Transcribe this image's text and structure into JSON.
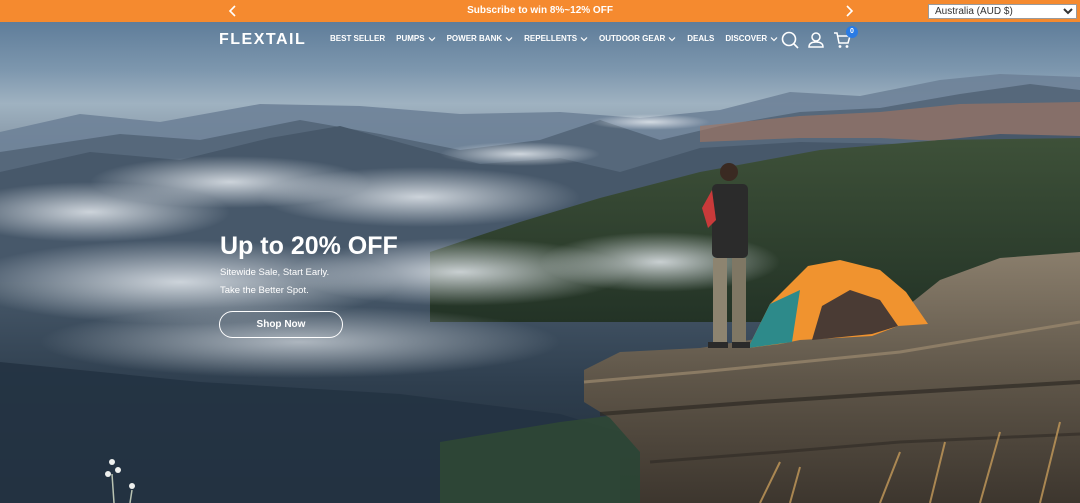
{
  "announcement": {
    "text": "Subscribe to win 8%~12% OFF",
    "background": "#f58a2f"
  },
  "region_select": {
    "selected": "Australia (AUD $)"
  },
  "header": {
    "logo": "FLEXTAIL",
    "nav": [
      {
        "label": "BEST SELLER",
        "dropdown": false
      },
      {
        "label": "PUMPS",
        "dropdown": true
      },
      {
        "label": "POWER BANK",
        "dropdown": true
      },
      {
        "label": "REPELLENTS",
        "dropdown": true
      },
      {
        "label": "OUTDOOR GEAR",
        "dropdown": true
      },
      {
        "label": "DEALS",
        "dropdown": false
      },
      {
        "label": "DISCOVER",
        "dropdown": true
      }
    ],
    "icons": [
      "search-icon",
      "account-icon",
      "cart-icon"
    ],
    "cart_count": "0",
    "cart_badge_color": "#2a7be4"
  },
  "hero": {
    "headline": "Up to 20% OFF",
    "subline_1": "Sitewide Sale, Start Early.",
    "subline_2": "Take the Better Spot.",
    "cta_label": "Shop Now"
  }
}
